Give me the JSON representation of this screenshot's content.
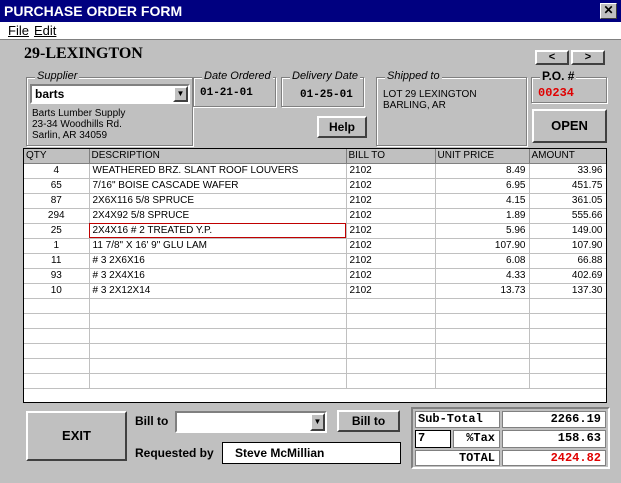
{
  "window": {
    "title": "PURCHASE ORDER FORM",
    "close_glyph": "✕"
  },
  "menu": {
    "file": "File",
    "edit": "Edit"
  },
  "job_title": "29-LEXINGTON",
  "nav": {
    "prev": "<",
    "next": ">"
  },
  "supplier": {
    "label": "Supplier",
    "selected": "barts",
    "address": [
      "Barts Lumber Supply",
      "23-34 Woodhills Rd.",
      "Sarlin, AR 34059"
    ]
  },
  "date_ordered": {
    "label": "Date Ordered",
    "value": "01-21-01"
  },
  "delivery_date": {
    "label": "Delivery Date",
    "value": "01-25-01"
  },
  "help_button": "Help",
  "shipped_to": {
    "label": "Shipped to",
    "lines": [
      "LOT 29 LEXINGTON",
      "BARLING, AR"
    ]
  },
  "po": {
    "label": "P.O. #",
    "value": "00234"
  },
  "open_button": "OPEN",
  "table": {
    "headers": [
      "QTY",
      "DESCRIPTION",
      "BILL TO",
      "UNIT PRICE",
      "AMOUNT"
    ],
    "rows": [
      {
        "qty": "4",
        "desc": "WEATHERED BRZ. SLANT ROOF LOUVERS",
        "bill": "2102",
        "price": "8.49",
        "amount": "33.96"
      },
      {
        "qty": "65",
        "desc": "7/16\" BOISE CASCADE WAFER",
        "bill": "2102",
        "price": "6.95",
        "amount": "451.75"
      },
      {
        "qty": "87",
        "desc": "2X6X116 5/8 SPRUCE",
        "bill": "2102",
        "price": "4.15",
        "amount": "361.05"
      },
      {
        "qty": "294",
        "desc": "2X4X92 5/8 SPRUCE",
        "bill": "2102",
        "price": "1.89",
        "amount": "555.66"
      },
      {
        "qty": "25",
        "desc": "2X4X16 # 2 TREATED Y.P.",
        "bill": "2102",
        "price": "5.96",
        "amount": "149.00"
      },
      {
        "qty": "1",
        "desc": "11 7/8\" X 16' 9\" GLU LAM",
        "bill": "2102",
        "price": "107.90",
        "amount": "107.90"
      },
      {
        "qty": "11",
        "desc": "# 3 2X6X16",
        "bill": "2102",
        "price": "6.08",
        "amount": "66.88"
      },
      {
        "qty": "93",
        "desc": "# 3 2X4X16",
        "bill": "2102",
        "price": "4.33",
        "amount": "402.69"
      },
      {
        "qty": "10",
        "desc": "# 3 2X12X14",
        "bill": "2102",
        "price": "13.73",
        "amount": "137.30"
      }
    ],
    "empty_rows": 6
  },
  "exit_button": "EXIT",
  "bill_to": {
    "label": "Bill to",
    "value": "",
    "button": "Bill to"
  },
  "requested_by": {
    "label": "Requested by",
    "value": "Steve McMillian"
  },
  "totals": {
    "subtotal_label": "Sub-Total",
    "subtotal": "2266.19",
    "tax_rate": "7",
    "tax_label": "%Tax",
    "tax": "158.63",
    "total_label": "TOTAL",
    "total": "2424.82"
  },
  "colors": {
    "titlebar": "#000080",
    "accent_red": "#e00000",
    "face": "#c0c0c0"
  }
}
